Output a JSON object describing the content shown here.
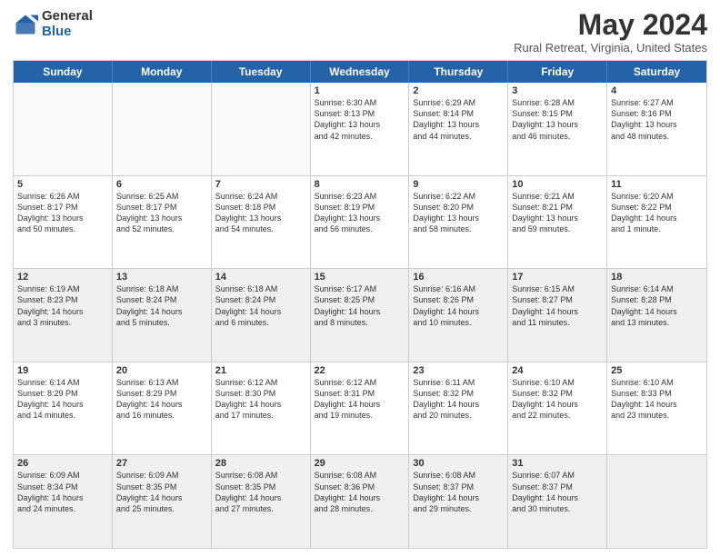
{
  "header": {
    "logo_general": "General",
    "logo_blue": "Blue",
    "month_title": "May 2024",
    "location": "Rural Retreat, Virginia, United States"
  },
  "weekdays": [
    "Sunday",
    "Monday",
    "Tuesday",
    "Wednesday",
    "Thursday",
    "Friday",
    "Saturday"
  ],
  "rows": [
    [
      {
        "day": "",
        "info": "",
        "empty": true
      },
      {
        "day": "",
        "info": "",
        "empty": true
      },
      {
        "day": "",
        "info": "",
        "empty": true
      },
      {
        "day": "1",
        "info": "Sunrise: 6:30 AM\nSunset: 8:13 PM\nDaylight: 13 hours\nand 42 minutes."
      },
      {
        "day": "2",
        "info": "Sunrise: 6:29 AM\nSunset: 8:14 PM\nDaylight: 13 hours\nand 44 minutes."
      },
      {
        "day": "3",
        "info": "Sunrise: 6:28 AM\nSunset: 8:15 PM\nDaylight: 13 hours\nand 46 minutes."
      },
      {
        "day": "4",
        "info": "Sunrise: 6:27 AM\nSunset: 8:16 PM\nDaylight: 13 hours\nand 48 minutes."
      }
    ],
    [
      {
        "day": "5",
        "info": "Sunrise: 6:26 AM\nSunset: 8:17 PM\nDaylight: 13 hours\nand 50 minutes."
      },
      {
        "day": "6",
        "info": "Sunrise: 6:25 AM\nSunset: 8:17 PM\nDaylight: 13 hours\nand 52 minutes."
      },
      {
        "day": "7",
        "info": "Sunrise: 6:24 AM\nSunset: 8:18 PM\nDaylight: 13 hours\nand 54 minutes."
      },
      {
        "day": "8",
        "info": "Sunrise: 6:23 AM\nSunset: 8:19 PM\nDaylight: 13 hours\nand 56 minutes."
      },
      {
        "day": "9",
        "info": "Sunrise: 6:22 AM\nSunset: 8:20 PM\nDaylight: 13 hours\nand 58 minutes."
      },
      {
        "day": "10",
        "info": "Sunrise: 6:21 AM\nSunset: 8:21 PM\nDaylight: 13 hours\nand 59 minutes."
      },
      {
        "day": "11",
        "info": "Sunrise: 6:20 AM\nSunset: 8:22 PM\nDaylight: 14 hours\nand 1 minute."
      }
    ],
    [
      {
        "day": "12",
        "info": "Sunrise: 6:19 AM\nSunset: 8:23 PM\nDaylight: 14 hours\nand 3 minutes.",
        "shaded": true
      },
      {
        "day": "13",
        "info": "Sunrise: 6:18 AM\nSunset: 8:24 PM\nDaylight: 14 hours\nand 5 minutes.",
        "shaded": true
      },
      {
        "day": "14",
        "info": "Sunrise: 6:18 AM\nSunset: 8:24 PM\nDaylight: 14 hours\nand 6 minutes.",
        "shaded": true
      },
      {
        "day": "15",
        "info": "Sunrise: 6:17 AM\nSunset: 8:25 PM\nDaylight: 14 hours\nand 8 minutes.",
        "shaded": true
      },
      {
        "day": "16",
        "info": "Sunrise: 6:16 AM\nSunset: 8:26 PM\nDaylight: 14 hours\nand 10 minutes.",
        "shaded": true
      },
      {
        "day": "17",
        "info": "Sunrise: 6:15 AM\nSunset: 8:27 PM\nDaylight: 14 hours\nand 11 minutes.",
        "shaded": true
      },
      {
        "day": "18",
        "info": "Sunrise: 6:14 AM\nSunset: 8:28 PM\nDaylight: 14 hours\nand 13 minutes.",
        "shaded": true
      }
    ],
    [
      {
        "day": "19",
        "info": "Sunrise: 6:14 AM\nSunset: 8:29 PM\nDaylight: 14 hours\nand 14 minutes."
      },
      {
        "day": "20",
        "info": "Sunrise: 6:13 AM\nSunset: 8:29 PM\nDaylight: 14 hours\nand 16 minutes."
      },
      {
        "day": "21",
        "info": "Sunrise: 6:12 AM\nSunset: 8:30 PM\nDaylight: 14 hours\nand 17 minutes."
      },
      {
        "day": "22",
        "info": "Sunrise: 6:12 AM\nSunset: 8:31 PM\nDaylight: 14 hours\nand 19 minutes."
      },
      {
        "day": "23",
        "info": "Sunrise: 6:11 AM\nSunset: 8:32 PM\nDaylight: 14 hours\nand 20 minutes."
      },
      {
        "day": "24",
        "info": "Sunrise: 6:10 AM\nSunset: 8:32 PM\nDaylight: 14 hours\nand 22 minutes."
      },
      {
        "day": "25",
        "info": "Sunrise: 6:10 AM\nSunset: 8:33 PM\nDaylight: 14 hours\nand 23 minutes."
      }
    ],
    [
      {
        "day": "26",
        "info": "Sunrise: 6:09 AM\nSunset: 8:34 PM\nDaylight: 14 hours\nand 24 minutes.",
        "shaded": true
      },
      {
        "day": "27",
        "info": "Sunrise: 6:09 AM\nSunset: 8:35 PM\nDaylight: 14 hours\nand 25 minutes.",
        "shaded": true
      },
      {
        "day": "28",
        "info": "Sunrise: 6:08 AM\nSunset: 8:35 PM\nDaylight: 14 hours\nand 27 minutes.",
        "shaded": true
      },
      {
        "day": "29",
        "info": "Sunrise: 6:08 AM\nSunset: 8:36 PM\nDaylight: 14 hours\nand 28 minutes.",
        "shaded": true
      },
      {
        "day": "30",
        "info": "Sunrise: 6:08 AM\nSunset: 8:37 PM\nDaylight: 14 hours\nand 29 minutes.",
        "shaded": true
      },
      {
        "day": "31",
        "info": "Sunrise: 6:07 AM\nSunset: 8:37 PM\nDaylight: 14 hours\nand 30 minutes.",
        "shaded": true
      },
      {
        "day": "",
        "info": "",
        "empty": true,
        "shaded": true
      }
    ]
  ]
}
